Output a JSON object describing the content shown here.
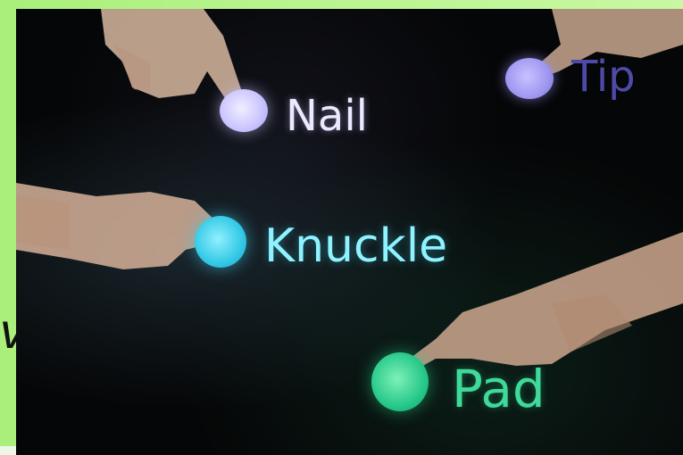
{
  "labels": {
    "tip": "Tip",
    "nail": "Nail",
    "knuckle": "Knuckle",
    "pad": "Pad"
  },
  "side_text": "v",
  "colors": {
    "frame": "#b8f48d",
    "background": "#050607",
    "tip": "#9f97f0",
    "nail": "#c9c4ff",
    "knuckle": "#34c9e6",
    "pad": "#26c98a"
  }
}
